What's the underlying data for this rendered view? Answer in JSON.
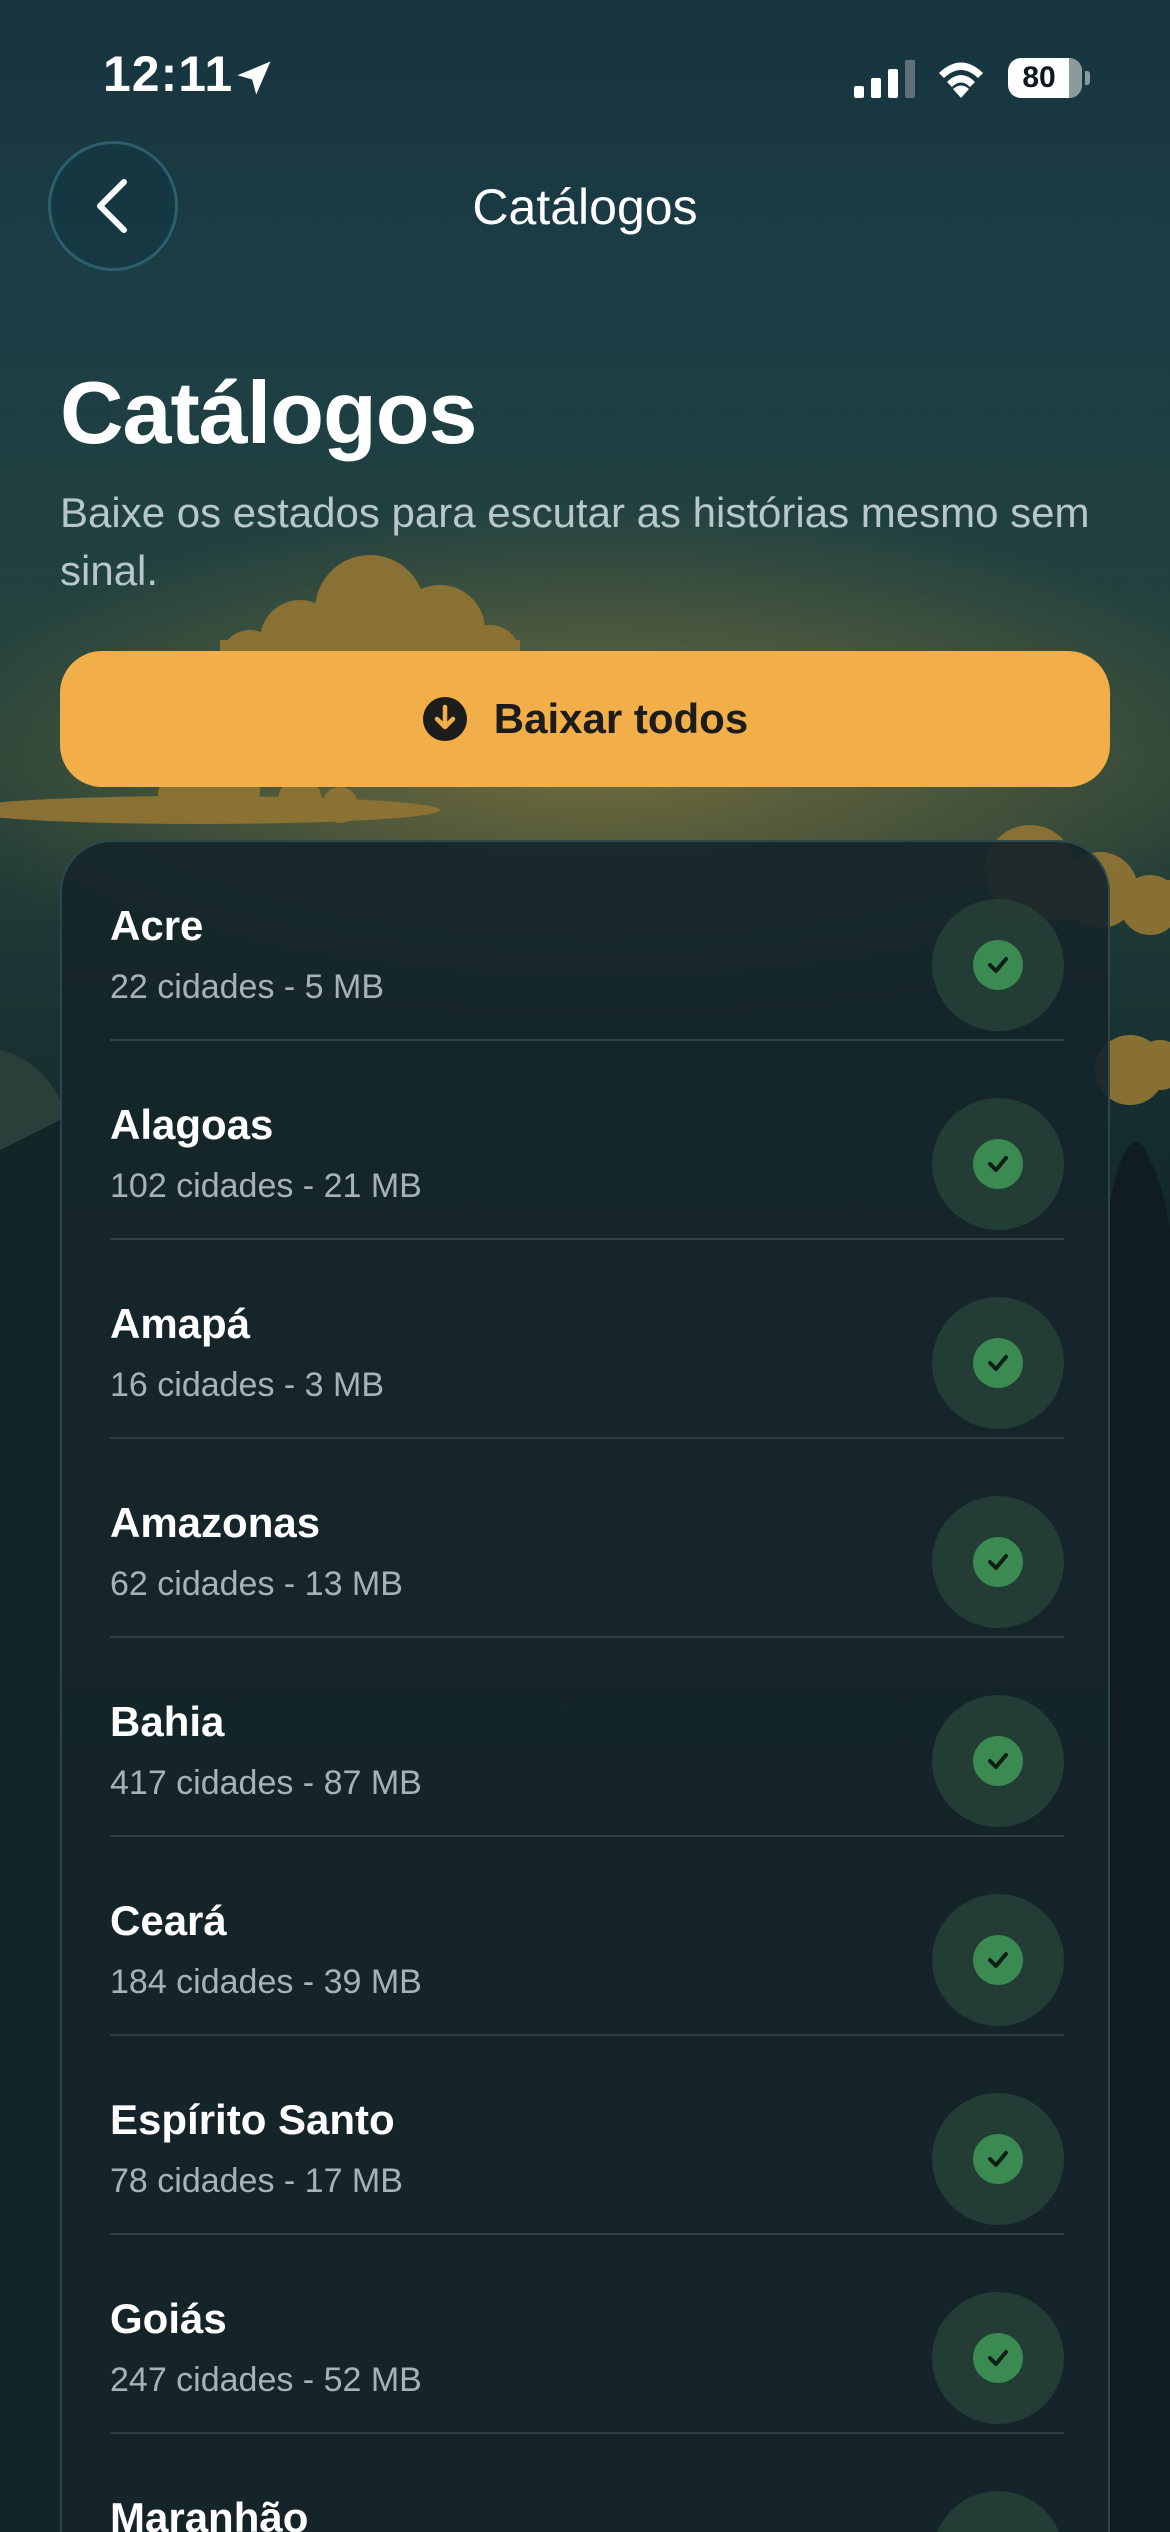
{
  "status_bar": {
    "time": "12:11",
    "battery": "80"
  },
  "nav": {
    "title": "Catálogos",
    "back_icon": "chevron-left-icon"
  },
  "header": {
    "title": "Catálogos",
    "subtitle": "Baixe os estados para escutar as histórias mesmo sem sinal."
  },
  "download_all": {
    "label": "Baixar todos",
    "icon": "download-circle-icon"
  },
  "states": [
    {
      "name": "Acre",
      "meta": "22 cidades - 5 MB",
      "downloaded": true
    },
    {
      "name": "Alagoas",
      "meta": "102 cidades - 21 MB",
      "downloaded": true
    },
    {
      "name": "Amapá",
      "meta": "16 cidades - 3 MB",
      "downloaded": true
    },
    {
      "name": "Amazonas",
      "meta": "62 cidades - 13 MB",
      "downloaded": true
    },
    {
      "name": "Bahia",
      "meta": "417 cidades - 87 MB",
      "downloaded": true
    },
    {
      "name": "Ceará",
      "meta": "184 cidades - 39 MB",
      "downloaded": true
    },
    {
      "name": "Espírito Santo",
      "meta": "78 cidades - 17 MB",
      "downloaded": true
    },
    {
      "name": "Goiás",
      "meta": "247 cidades - 52 MB",
      "downloaded": true
    },
    {
      "name": "Maranhão",
      "meta": "",
      "downloaded": true
    }
  ],
  "colors": {
    "accent": "#f2ae48",
    "check": "#3a8a52",
    "background": "#0d1a1f"
  }
}
